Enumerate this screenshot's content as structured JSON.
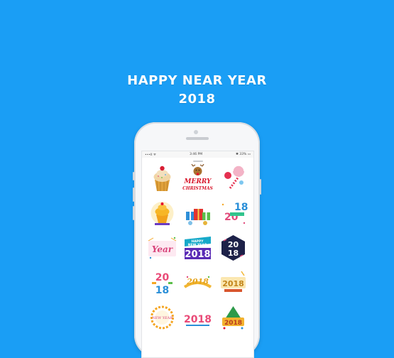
{
  "headline": {
    "line1": "HAPPY NEAR YEAR",
    "line2": "2018"
  },
  "statusbar": {
    "carrier": "•••ll ᯤ",
    "time": "3:46 PM",
    "battery": "✱ 33% ▭"
  },
  "stickers": [
    {
      "name": "cupcake"
    },
    {
      "name": "reindeer-merry-christmas"
    },
    {
      "name": "candy-lollipop"
    },
    {
      "name": "golden-cupcake"
    },
    {
      "name": "gift-boxes"
    },
    {
      "name": "2018-colorful-badge"
    },
    {
      "name": "new-year-label"
    },
    {
      "name": "happy-new-year-2018-banner"
    },
    {
      "name": "2018-dark-hexagon"
    },
    {
      "name": "2018-stacked-numbers"
    },
    {
      "name": "2018-gold-ribbon"
    },
    {
      "name": "2018-gold-sign"
    },
    {
      "name": "new-year-wreath"
    },
    {
      "name": "2018-bold"
    },
    {
      "name": "2018-festive-tree"
    }
  ],
  "sticker_text": {
    "merry": "MERRY",
    "xmas": "CHRISTMAS",
    "year": "Year",
    "happy": "HAPPY",
    "newyear": "NEW YEAR",
    "num_2018": "2018",
    "n20": "20",
    "n18": "18"
  }
}
